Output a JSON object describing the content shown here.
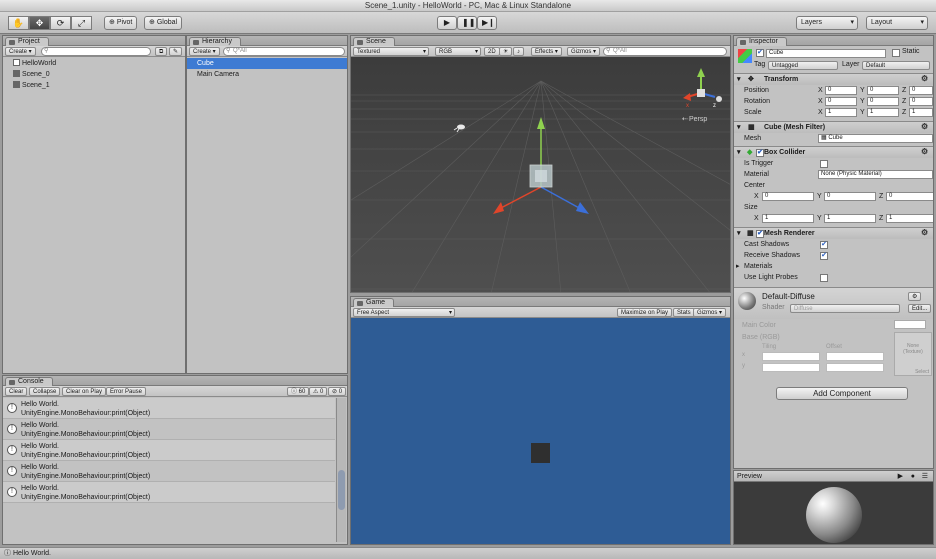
{
  "window": {
    "title": "Scene_1.unity - HelloWorld - PC, Mac & Linux Standalone"
  },
  "toolbar": {
    "tools": [
      "hand-icon",
      "move-icon",
      "rotate-icon",
      "scale-icon"
    ],
    "pivot": "Pivot",
    "global": "Global",
    "layers": "Layers",
    "layout": "Layout"
  },
  "project": {
    "tab": "Project",
    "create": "Create",
    "items": [
      "HelloWorld",
      "Scene_0",
      "Scene_1"
    ]
  },
  "hierarchy": {
    "tab": "Hierarchy",
    "create": "Create",
    "search": "Q*All",
    "items": [
      "Cube",
      "Main Camera"
    ]
  },
  "scene": {
    "tab": "Scene",
    "shading": "Textured",
    "mode": "RGB",
    "twod": "2D",
    "effects": "Effects",
    "gizmos": "Gizmos",
    "persp": "Persp",
    "search": "Q*All"
  },
  "game": {
    "tab": "Game",
    "aspect": "Free Aspect",
    "maximize": "Maximize on Play",
    "stats": "Stats",
    "gizmos": "Gizmos"
  },
  "console": {
    "tab": "Console",
    "clear": "Clear",
    "collapse": "Collapse",
    "clear_on_play": "Clear on Play",
    "error_pause": "Error Pause",
    "counts": [
      "60",
      "0",
      "0"
    ],
    "entries": [
      {
        "line1": "Hello World.",
        "line2": "UnityEngine.MonoBehaviour:print(Object)"
      },
      {
        "line1": "Hello World.",
        "line2": "UnityEngine.MonoBehaviour:print(Object)"
      },
      {
        "line1": "Hello World.",
        "line2": "UnityEngine.MonoBehaviour:print(Object)"
      },
      {
        "line1": "Hello World.",
        "line2": "UnityEngine.MonoBehaviour:print(Object)"
      },
      {
        "line1": "Hello World.",
        "line2": "UnityEngine.MonoBehaviour:print(Object)"
      }
    ]
  },
  "inspector": {
    "tab": "Inspector",
    "object_name": "Cube",
    "static": "Static",
    "tag_label": "Tag",
    "tag_value": "Untagged",
    "layer_label": "Layer",
    "layer_value": "Default",
    "transform": {
      "title": "Transform",
      "position": {
        "label": "Position",
        "x": "0",
        "y": "0",
        "z": "0"
      },
      "rotation": {
        "label": "Rotation",
        "x": "0",
        "y": "0",
        "z": "0"
      },
      "scale": {
        "label": "Scale",
        "x": "1",
        "y": "1",
        "z": "1"
      }
    },
    "mesh_filter": {
      "title": "Cube (Mesh Filter)",
      "mesh_label": "Mesh",
      "mesh_value": "Cube"
    },
    "box_collider": {
      "title": "Box Collider",
      "is_trigger": "Is Trigger",
      "material": "Material",
      "material_value": "None (Physic Material)",
      "center": "Center",
      "center_x": "0",
      "center_y": "0",
      "center_z": "0",
      "size": "Size",
      "size_x": "1",
      "size_y": "1",
      "size_z": "1"
    },
    "mesh_renderer": {
      "title": "Mesh Renderer",
      "cast_shadows": "Cast Shadows",
      "receive_shadows": "Receive Shadows",
      "materials": "Materials",
      "light_probes": "Use Light Probes"
    },
    "material": {
      "name": "Default-Diffuse",
      "shader_label": "Shader",
      "shader_value": "Diffuse",
      "edit": "Edit...",
      "main_color": "Main Color",
      "base": "Base (RGB)",
      "tiling": "Tiling",
      "offset": "Offset",
      "tex_none": "None",
      "tex_type": "(Texture)",
      "select": "Select"
    },
    "add_component": "Add Component",
    "preview": "Preview"
  },
  "status": {
    "message": "Hello World."
  },
  "colors": {
    "selection": "#3e7bd3",
    "game_bg": "#2e5c95",
    "scene_bg": "#4a4a4a"
  }
}
